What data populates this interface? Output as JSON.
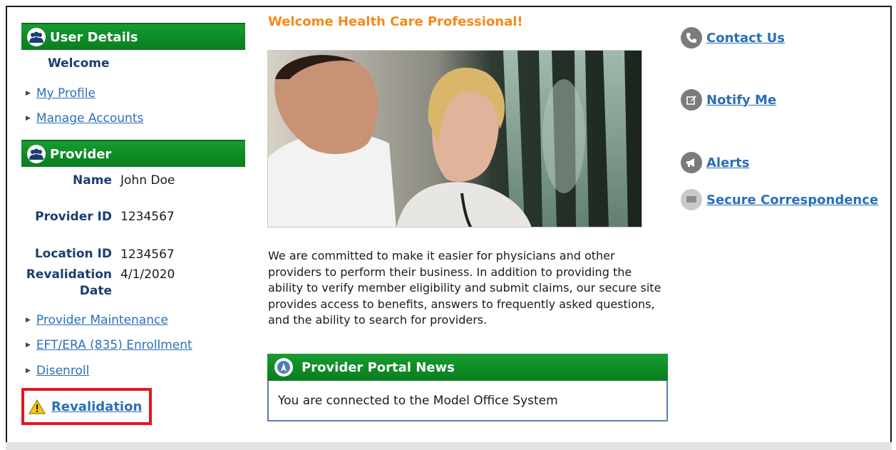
{
  "user_details": {
    "title": "User Details",
    "welcome": "Welcome",
    "links": [
      "My Profile",
      "Manage Accounts"
    ]
  },
  "provider": {
    "title": "Provider",
    "name_label": "Name",
    "name_value": "John Doe",
    "id_label": "Provider ID",
    "id_value": "1234567",
    "location_label": "Location ID",
    "location_value": "1234567",
    "revalidation_label_1": "Revalidation",
    "revalidation_label_2": "Date",
    "revalidation_value": "4/1/2020",
    "links": [
      "Provider Maintenance",
      "EFT/ERA (835) Enrollment",
      "Disenroll"
    ],
    "revalidation_link": "Revalidation"
  },
  "main": {
    "welcome_heading": "Welcome Health Care Professional!",
    "blurb": "We are committed to make it easier for physicians and other providers to perform their business. In addition to providing the ability to verify member eligibility and submit claims, our secure site provides access to benefits, answers to frequently asked questions, and the ability to search for providers.",
    "news_title": "Provider Portal News",
    "news_text": "You are connected to the Model Office System"
  },
  "right_links": {
    "contact": "Contact Us",
    "notify": "Notify Me",
    "alerts": "Alerts",
    "secure": "Secure Correspondence"
  },
  "colors": {
    "section_green": "#0c8a24",
    "link_blue": "#2a6fb8",
    "heading_orange": "#f28a1b",
    "label_navy": "#1b3e70",
    "highlight_red": "#e2171f"
  },
  "icons": [
    "users-icon",
    "phone-icon",
    "edit-icon",
    "megaphone-icon",
    "message-icon",
    "warning-icon",
    "news-icon"
  ]
}
